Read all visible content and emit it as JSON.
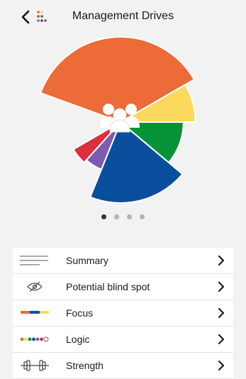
{
  "header": {
    "title": "Management Drives",
    "back_icon": "chevron-left-icon",
    "logo_icon": "dots-logo-icon"
  },
  "colors": {
    "orange": "#ec6b36",
    "yellow": "#fcd95c",
    "green": "#069338",
    "blue": "#0a4f9e",
    "purple": "#7b5cb2",
    "red": "#dc2e3c"
  },
  "chart_data": {
    "type": "pie",
    "slices": [
      {
        "color": "#ec6b36",
        "start_deg": 200,
        "end_deg": 330,
        "radius": 1.0
      },
      {
        "color": "#fcd95c",
        "start_deg": 330,
        "end_deg": 360,
        "radius": 0.88
      },
      {
        "color": "#069338",
        "start_deg": 0,
        "end_deg": 40,
        "radius": 0.74
      },
      {
        "color": "#0a4f9e",
        "start_deg": 40,
        "end_deg": 112,
        "radius": 0.95
      },
      {
        "color": "#7b5cb2",
        "start_deg": 112,
        "end_deg": 132,
        "radius": 0.6
      },
      {
        "color": "#dc2e3c",
        "start_deg": 132,
        "end_deg": 150,
        "radius": 0.64
      }
    ],
    "center_icon": "people-group-icon"
  },
  "pager": {
    "count": 4,
    "active": 0
  },
  "menu": [
    {
      "label": "Summary",
      "icon": "summary-lines-icon"
    },
    {
      "label": "Potential blind spot",
      "icon": "eye-slash-icon"
    },
    {
      "label": "Focus",
      "icon": "focus-bar-icon"
    },
    {
      "label": "Logic",
      "icon": "logic-dots-icon"
    },
    {
      "label": "Strength",
      "icon": "dumbbell-icon"
    }
  ]
}
